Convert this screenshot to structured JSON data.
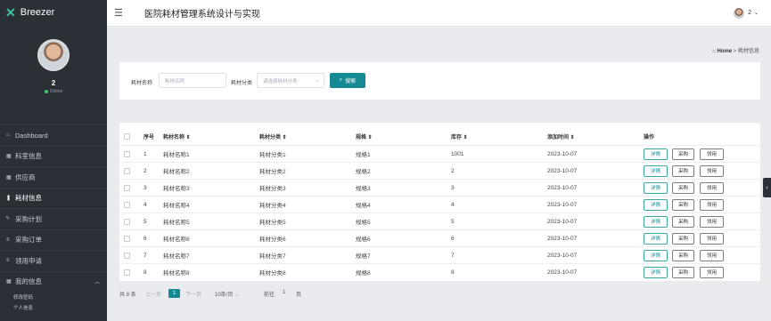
{
  "app": {
    "brand": "Breezer",
    "title": "医院耗材管理系统设计与实现"
  },
  "user": {
    "name": "2",
    "status": "Online",
    "top_name": "2"
  },
  "sidebar": {
    "items": [
      {
        "icon": "home-icon",
        "glyph": "⌂",
        "label": "Dashboard"
      },
      {
        "icon": "grid-icon",
        "glyph": "▦",
        "label": "科室信息"
      },
      {
        "icon": "grid-icon",
        "glyph": "▦",
        "label": "供应商"
      },
      {
        "icon": "comment-icon",
        "glyph": "❚",
        "label": "耗材信息"
      },
      {
        "icon": "bolt-icon",
        "glyph": "ϟ",
        "label": "采购计划"
      },
      {
        "icon": "list-icon",
        "glyph": "≡",
        "label": "采购订单"
      },
      {
        "icon": "list-icon",
        "glyph": "≡",
        "label": "领用申请"
      },
      {
        "icon": "grid-icon",
        "glyph": "▦",
        "label": "我的信息"
      }
    ],
    "sub_items": [
      "修改密码",
      "个人信息"
    ]
  },
  "breadcrumb": {
    "home": "Home",
    "sep": ">",
    "current": "耗材信息"
  },
  "search": {
    "name_label": "耗材名称",
    "name_placeholder": "耗材名称",
    "category_label": "耗材分类",
    "category_placeholder": "请选择耗材分类",
    "button": "搜索"
  },
  "table": {
    "headers": [
      "序号",
      "耗材名称 ⇕",
      "耗材分类 ⇕",
      "规格 ⇕",
      "库存 ⇕",
      "添加时间 ⇕",
      "操作"
    ],
    "rows": [
      {
        "id": "1",
        "name": "耗材名称1",
        "category": "耗材分类1",
        "spec": "规格1",
        "stock": "1001",
        "date": "2023-10-07"
      },
      {
        "id": "2",
        "name": "耗材名称2",
        "category": "耗材分类2",
        "spec": "规格2",
        "stock": "2",
        "date": "2023-10-07"
      },
      {
        "id": "3",
        "name": "耗材名称3",
        "category": "耗材分类3",
        "spec": "规格3",
        "stock": "3",
        "date": "2023-10-07"
      },
      {
        "id": "4",
        "name": "耗材名称4",
        "category": "耗材分类4",
        "spec": "规格4",
        "stock": "4",
        "date": "2023-10-07"
      },
      {
        "id": "5",
        "name": "耗材名称5",
        "category": "耗材分类5",
        "spec": "规格5",
        "stock": "5",
        "date": "2023-10-07"
      },
      {
        "id": "6",
        "name": "耗材名称6",
        "category": "耗材分类6",
        "spec": "规格6",
        "stock": "6",
        "date": "2023-10-07"
      },
      {
        "id": "7",
        "name": "耗材名称7",
        "category": "耗材分类7",
        "spec": "规格7",
        "stock": "7",
        "date": "2023-10-07"
      },
      {
        "id": "8",
        "name": "耗材名称8",
        "category": "耗材分类8",
        "spec": "规格8",
        "stock": "8",
        "date": "2023-10-07"
      }
    ],
    "actions": [
      "详情",
      "采购",
      "领用"
    ]
  },
  "pagination": {
    "total": "共 8 条",
    "prev": "上一页",
    "current": "1",
    "next": "下一页",
    "page_size": "10条/页",
    "goto_label": "前往",
    "goto_value": "1",
    "goto_suffix": "页"
  },
  "colors": {
    "accent": "#168a94",
    "sidebar_bg": "#2b2f36",
    "brand_icon": "#3fc1a5",
    "online": "#3fc56b"
  }
}
